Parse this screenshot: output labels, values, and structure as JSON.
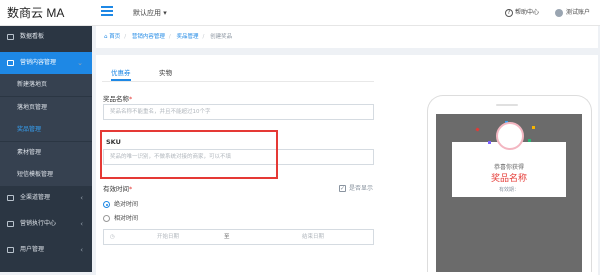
{
  "header": {
    "logo": "数商云 MA",
    "app_select": "默认应用 ▾",
    "help": "帮助中心",
    "user": "测试账户"
  },
  "sidebar": {
    "items": [
      {
        "label": "数据看板"
      },
      {
        "label": "营销内容管理"
      },
      {
        "label": "全渠道管理"
      },
      {
        "label": "营销执行中心"
      },
      {
        "label": "用户管理"
      }
    ],
    "sub_items": [
      {
        "label": "新建落地页"
      },
      {
        "label": "落地页管理"
      },
      {
        "label": "奖品管理"
      },
      {
        "label": "素材管理"
      },
      {
        "label": "短信模板管理"
      }
    ]
  },
  "breadcrumb": {
    "home": "首页",
    "level1": "营销内容管理",
    "level2": "奖品管理",
    "current": "创建奖品"
  },
  "tabs": [
    "优惠券",
    "实物"
  ],
  "form": {
    "prize_name_label": "奖品名称",
    "prize_name_required": "*",
    "prize_name_placeholder": "奖品名称不能重名，并且不能超过10个字",
    "sku_label": "SKU",
    "sku_placeholder": "奖品的唯一识别，不做系统对接的商家，可以不填",
    "valid_time_label": "有效时间",
    "valid_time_required": "*",
    "show_label": "是否显示",
    "check_mark": "✓",
    "absolute_time": "绝对时间",
    "relative_time": "相对时间",
    "start_date": "开始日期",
    "to": "至",
    "end_date": "结束日期"
  },
  "preview": {
    "congrats": "恭喜你获得",
    "prize_name": "奖品名称",
    "validity": "有效期："
  },
  "colors": {
    "accent": "#1e88e5",
    "sidebar_bg": "#2b3643",
    "highlight": "#e53935"
  }
}
